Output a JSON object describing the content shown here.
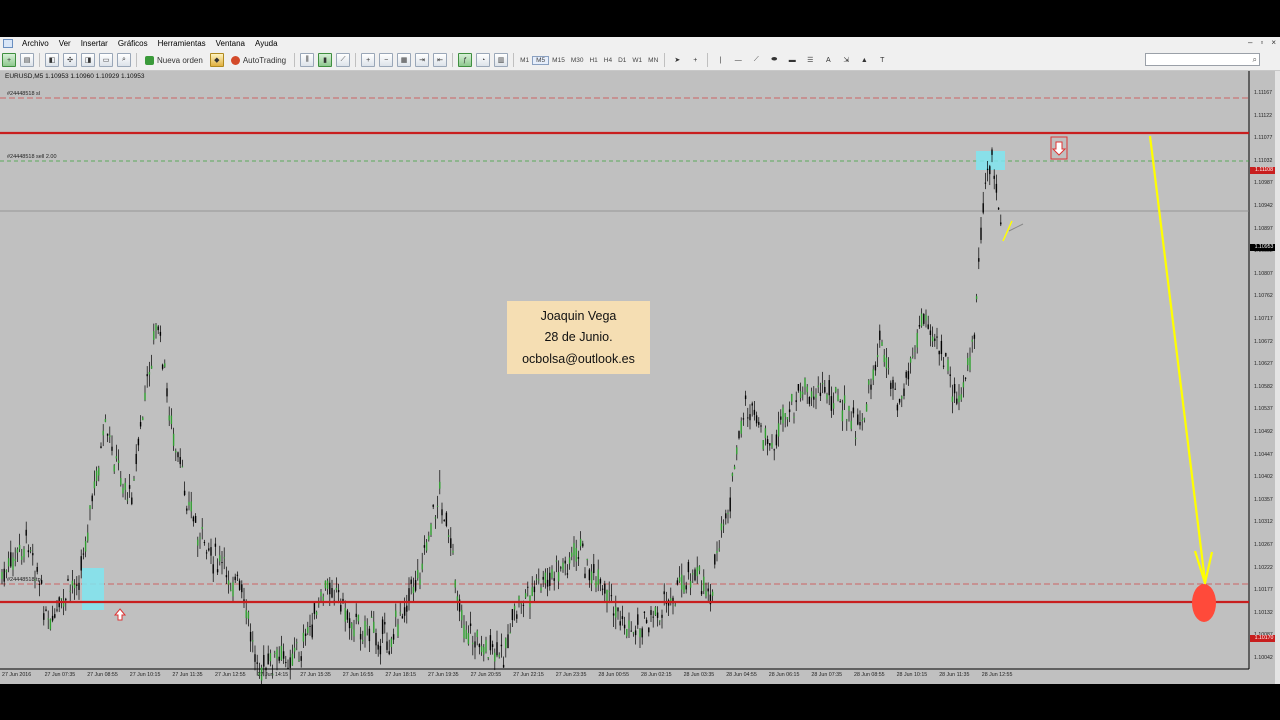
{
  "menu": {
    "items": [
      "Archivo",
      "Ver",
      "Insertar",
      "Gráficos",
      "Herramientas",
      "Ventana",
      "Ayuda"
    ],
    "window_controls": [
      "–",
      "▫",
      "×"
    ]
  },
  "toolbar": {
    "new_order_label": "Nueva orden",
    "autotrading_label": "AutoTrading",
    "timeframes": [
      "M1",
      "M5",
      "M15",
      "M30",
      "H1",
      "H4",
      "D1",
      "W1",
      "MN"
    ],
    "active_timeframe": "M5"
  },
  "chart": {
    "symbol_header": "EURUSD,M5  1.10953 1.10960 1.10929 1.10953",
    "orders": {
      "sl_label": "#24448518 sl",
      "sell_label": "#24448518 sell 2.00",
      "tp_label": "#24448518 tp"
    },
    "note": {
      "line1": "Joaquin Vega",
      "line2": "28 de Junio.",
      "line3": "ocbolsa@outlook.es"
    },
    "price_axis": [
      "1.11167",
      "1.11122",
      "1.11077",
      "1.11032",
      "1.10987",
      "1.10942",
      "1.10897",
      "1.10852",
      "1.10807",
      "1.10762",
      "1.10717",
      "1.10672",
      "1.10627",
      "1.10582",
      "1.10537",
      "1.10492",
      "1.10447",
      "1.10402",
      "1.10357",
      "1.10312",
      "1.10267",
      "1.10222",
      "1.10177",
      "1.10132",
      "1.10087",
      "1.10042"
    ],
    "price_tags": {
      "upper_line": "1.11108",
      "current": "1.10953",
      "lower_line": "1.10170"
    },
    "time_axis": [
      "27 Jun 2016",
      "27 Jun 07:35",
      "27 Jun 08:55",
      "27 Jun 10:15",
      "27 Jun 11:35",
      "27 Jun 12:55",
      "27 Jun 14:15",
      "27 Jun 15:35",
      "27 Jun 16:55",
      "27 Jun 18:15",
      "27 Jun 19:35",
      "27 Jun 20:55",
      "27 Jun 22:15",
      "27 Jun 23:35",
      "28 Jun 00:55",
      "28 Jun 02:15",
      "28 Jun 03:35",
      "28 Jun 04:55",
      "28 Jun 06:15",
      "28 Jun 07:35",
      "28 Jun 08:55",
      "28 Jun 10:15",
      "28 Jun 11:35",
      "28 Jun 12:55"
    ],
    "colors": {
      "background": "#c0c0c0",
      "resistance_support": "#c81e1e",
      "trend_arrow": "#ffff00",
      "target_marker": "#ff4a3a",
      "highlight": "#7fe5f0",
      "note_bg": "#f5deb3"
    }
  }
}
